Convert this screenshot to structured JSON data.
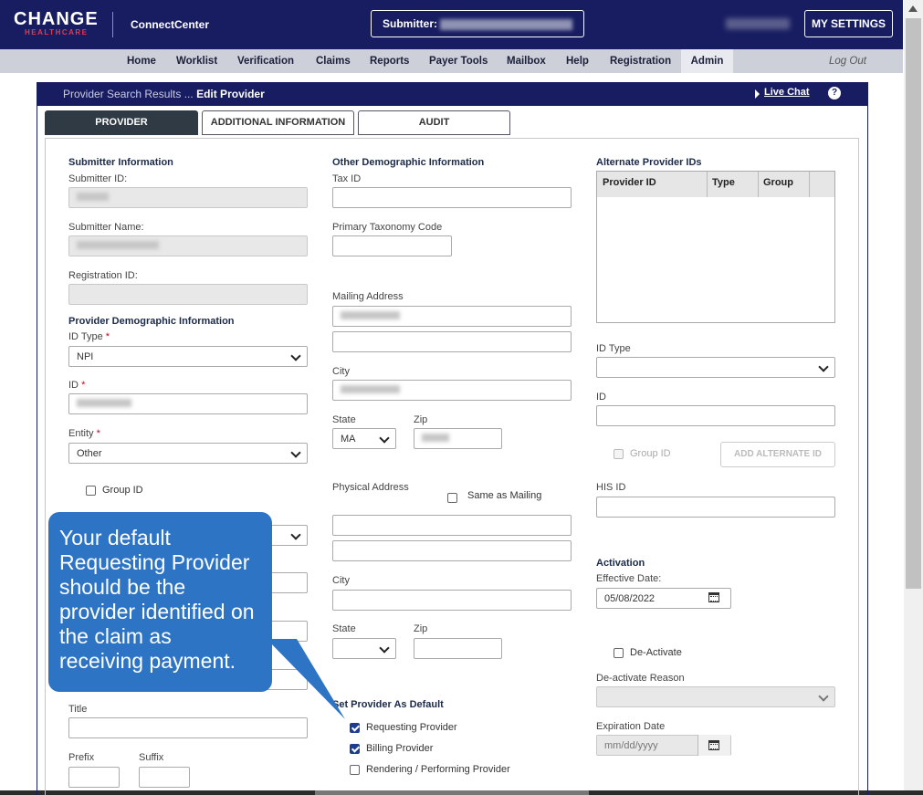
{
  "header": {
    "logo_main": "CHANGE",
    "logo_sub": "HEALTHCARE",
    "app_name": "ConnectCenter",
    "submitter_label": "Submitter:",
    "settings_label": "MY SETTINGS"
  },
  "nav": {
    "items": [
      "Home",
      "Worklist",
      "Verification",
      "Claims",
      "Reports",
      "Payer Tools",
      "Mailbox",
      "Help",
      "Registration",
      "Admin"
    ],
    "logout": "Log Out"
  },
  "panel": {
    "crumb_parent": "Provider Search Results ... ",
    "crumb_current": "Edit Provider",
    "live_chat": "Live Chat",
    "help": "?"
  },
  "tabs": [
    "PROVIDER",
    "ADDITIONAL INFORMATION",
    "AUDIT"
  ],
  "left": {
    "submitter_header": "Submitter Information",
    "submitter_id_label": "Submitter ID:",
    "submitter_name_label": "Submitter Name:",
    "registration_id_label": "Registration ID:",
    "demo_header": "Provider Demographic Information",
    "id_type_label": "ID Type",
    "id_type_value": "NPI",
    "id_label": "ID",
    "entity_label": "Entity",
    "entity_value": "Other",
    "group_id_label": "Group ID",
    "title_label": "Title",
    "prefix_label": "Prefix",
    "suffix_label": "Suffix",
    "required_mark": "*"
  },
  "middle": {
    "other_header": "Other Demographic Information",
    "tax_id_label": "Tax ID",
    "taxonomy_label": "Primary Taxonomy Code",
    "mailing_label": "Mailing Address",
    "city_label": "City",
    "state_label": "State",
    "state_value": "MA",
    "zip_label": "Zip",
    "physical_label": "Physical Address",
    "same_as_mailing": "Same as Mailing",
    "city2_label": "City",
    "state2_label": "State",
    "zip2_label": "Zip",
    "default_header": "Set Provider As Default",
    "requesting": "Requesting Provider",
    "billing": "Billing Provider",
    "rendering": "Rendering / Performing Provider"
  },
  "right": {
    "alt_header": "Alternate Provider IDs",
    "col_provider_id": "Provider ID",
    "col_type": "Type",
    "col_group": "Group",
    "id_type_label": "ID Type",
    "id_label": "ID",
    "group_id_label": "Group ID",
    "add_alt_button": "ADD ALTERNATE ID",
    "his_id_label": "HIS ID",
    "activation_header": "Activation",
    "effective_label": "Effective Date:",
    "effective_value": "05/08/2022",
    "deactivate_label": "De-Activate",
    "deactivate_reason_label": "De-activate Reason",
    "expiration_label": "Expiration Date",
    "expiration_placeholder": "mm/dd/yyyy"
  },
  "callout": {
    "text": "Your default Requesting Provider should be the provider identified on the claim as receiving payment."
  },
  "colors": {
    "header_navy": "#181d62",
    "callout_blue": "#2d74c4",
    "checkbox_blue": "#1c3d8f"
  }
}
